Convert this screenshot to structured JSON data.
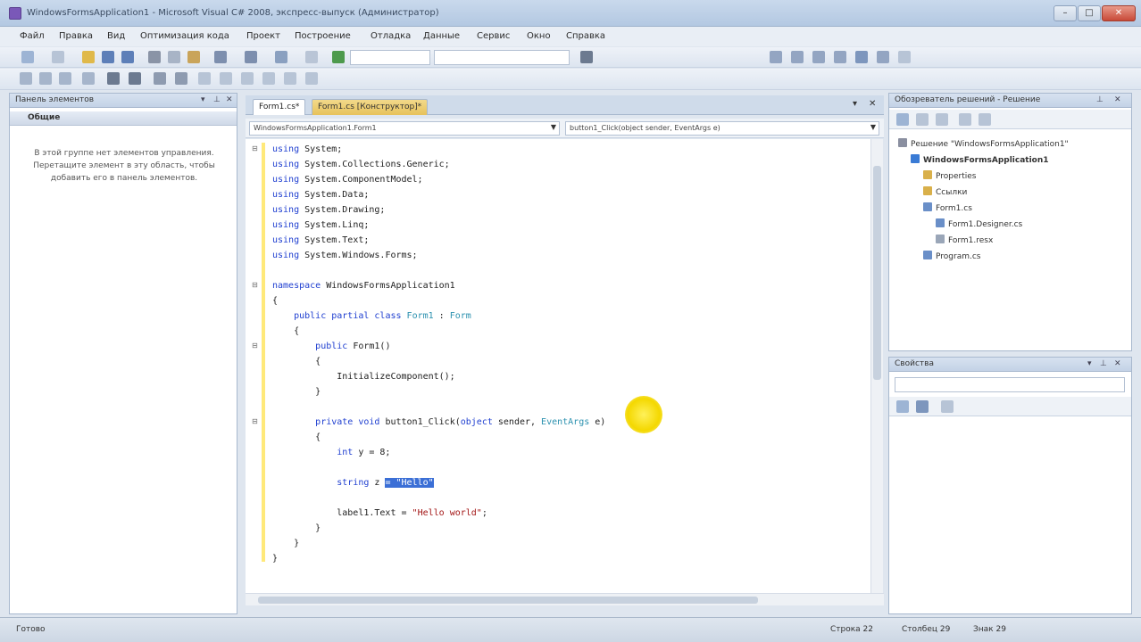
{
  "window": {
    "title": "WindowsFormsApplication1 - Microsoft Visual C# 2008, экспресс-выпуск (Администратор)",
    "minimize": "–",
    "maximize": "□",
    "close": "✕"
  },
  "menu": [
    "Файл",
    "Правка",
    "Вид",
    "Оптимизация кода",
    "Проект",
    "Построение",
    "Отладка",
    "Данные",
    "Сервис",
    "Окно",
    "Справка"
  ],
  "toolbox": {
    "title": "Панель элементов",
    "group": "Общие",
    "empty_message": "В этой группе нет элементов управления. Перетащите элемент в эту область, чтобы добавить его в панель элементов."
  },
  "editor": {
    "tabs": [
      {
        "label": "Form1.cs*",
        "active": true
      },
      {
        "label": "Form1.cs [Конструктор]*",
        "active": false
      }
    ],
    "nav_class": "WindowsFormsApplication1.Form1",
    "nav_member": "button1_Click(object sender, EventArgs e)",
    "lines": [
      [
        [
          "kw",
          "using"
        ],
        [
          "t",
          " System;"
        ]
      ],
      [
        [
          "kw",
          "using"
        ],
        [
          "t",
          " System.Collections.Generic;"
        ]
      ],
      [
        [
          "kw",
          "using"
        ],
        [
          "t",
          " System.ComponentModel;"
        ]
      ],
      [
        [
          "kw",
          "using"
        ],
        [
          "t",
          " System.Data;"
        ]
      ],
      [
        [
          "kw",
          "using"
        ],
        [
          "t",
          " System.Drawing;"
        ]
      ],
      [
        [
          "kw",
          "using"
        ],
        [
          "t",
          " System.Linq;"
        ]
      ],
      [
        [
          "kw",
          "using"
        ],
        [
          "t",
          " System.Text;"
        ]
      ],
      [
        [
          "kw",
          "using"
        ],
        [
          "t",
          " System.Windows.Forms;"
        ]
      ],
      [],
      [
        [
          "kw",
          "namespace"
        ],
        [
          "t",
          " WindowsFormsApplication1"
        ]
      ],
      [
        [
          "t",
          "{"
        ]
      ],
      [
        [
          "t",
          "    "
        ],
        [
          "kw",
          "public partial class"
        ],
        [
          "t",
          " "
        ],
        [
          "ty",
          "Form1"
        ],
        [
          "t",
          " : "
        ],
        [
          "ty",
          "Form"
        ]
      ],
      [
        [
          "t",
          "    {"
        ]
      ],
      [
        [
          "t",
          "        "
        ],
        [
          "kw",
          "public"
        ],
        [
          "t",
          " Form1()"
        ]
      ],
      [
        [
          "t",
          "        {"
        ]
      ],
      [
        [
          "t",
          "            InitializeComponent();"
        ]
      ],
      [
        [
          "t",
          "        }"
        ]
      ],
      [],
      [
        [
          "t",
          "        "
        ],
        [
          "kw",
          "private void"
        ],
        [
          "t",
          " button1_Click("
        ],
        [
          "kw",
          "object"
        ],
        [
          "t",
          " sender, "
        ],
        [
          "ty",
          "EventArgs"
        ],
        [
          "t",
          " e)"
        ]
      ],
      [
        [
          "t",
          "        {"
        ]
      ],
      [
        [
          "t",
          "            "
        ],
        [
          "kw",
          "int"
        ],
        [
          "t",
          " y = 8;"
        ]
      ],
      [],
      [
        [
          "t",
          "            "
        ],
        [
          "kw",
          "string"
        ],
        [
          "t",
          " z "
        ],
        [
          "sel",
          "= \"Hello\""
        ]
      ],
      [],
      [
        [
          "t",
          "            label1.Text = "
        ],
        [
          "str",
          "\"Hello world\""
        ],
        [
          "t",
          ";"
        ]
      ],
      [
        [
          "t",
          "        }"
        ]
      ],
      [
        [
          "t",
          "    }"
        ]
      ],
      [
        [
          "t",
          "}"
        ]
      ]
    ]
  },
  "solution": {
    "title": "Обозреватель решений - Решение",
    "items": [
      {
        "label": "Решение \"WindowsFormsApplication1\"",
        "level": 0,
        "icon": "solution-icon",
        "color": "#8a8fa0"
      },
      {
        "label": "WindowsFormsApplication1",
        "level": 1,
        "icon": "project-icon",
        "color": "#3a7bd5",
        "bold": true
      },
      {
        "label": "Properties",
        "level": 2,
        "icon": "folder-icon",
        "color": "#d9b04a"
      },
      {
        "label": "Ссылки",
        "level": 2,
        "icon": "folder-icon",
        "color": "#d9b04a"
      },
      {
        "label": "Form1.cs",
        "level": 2,
        "icon": "form-icon",
        "color": "#6a8fc8"
      },
      {
        "label": "Form1.Designer.cs",
        "level": 3,
        "icon": "cs-file-icon",
        "color": "#6a8fc8"
      },
      {
        "label": "Form1.resx",
        "level": 3,
        "icon": "resx-file-icon",
        "color": "#9aa6b8"
      },
      {
        "label": "Program.cs",
        "level": 2,
        "icon": "cs-file-icon",
        "color": "#6a8fc8"
      }
    ]
  },
  "properties": {
    "title": "Свойства"
  },
  "status": {
    "ready": "Готово",
    "line": "Строка 22",
    "col": "Столбец 29",
    "char": "Знак 29"
  }
}
